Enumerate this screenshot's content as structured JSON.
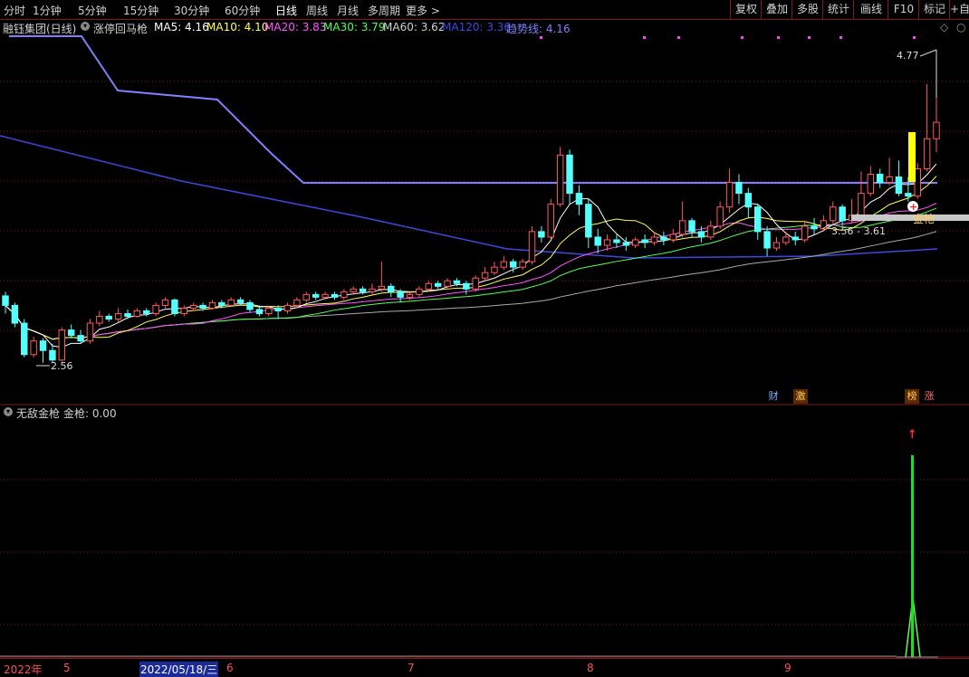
{
  "toolbar": {
    "periods": [
      "分时",
      "1分钟",
      "5分钟",
      "15分钟",
      "30分钟",
      "60分钟",
      "日线",
      "周线",
      "月线",
      "多周期",
      "更多 >"
    ],
    "active_period": "日线",
    "right_buttons": [
      "复权",
      "叠加",
      "多股",
      "统计",
      "画线",
      "F10",
      "标记",
      "+自"
    ]
  },
  "title_bar": {
    "stock_name": "融钰集团",
    "period": "(日线)",
    "formula_name": "涨停回马枪",
    "ma5_label": "MA5: 4.16",
    "ma10_label": "MA10: 4.10",
    "ma20_label": "MA20: 3.83",
    "ma30_label": "MA30: 3.79",
    "ma60_label": "MA60: 3.62",
    "ma120_label": "MA120: 3.36",
    "trend_label": "趋势线: 4.16"
  },
  "colors": {
    "up": "#ff5a5a",
    "down": "#54ffff",
    "ma5": "#ffffff",
    "ma10": "#ffff55",
    "ma20": "#ff55ff",
    "ma30": "#55ff55",
    "ma60": "#aaaaaa",
    "ma120": "#3a4ae0",
    "trend": "#8080ff",
    "grid": "#7a1c1c"
  },
  "annotations": {
    "high_label": "4.77",
    "low_label": "2.56",
    "range_label": "3.56 - 3.61",
    "jinqiang_label": "金枪"
  },
  "badges": [
    {
      "text": "财",
      "color": "#7fb2ff"
    },
    {
      "text": "激",
      "color": "#ffcc55"
    },
    {
      "text": "榜",
      "color": "#ffcc55"
    },
    {
      "text": "涨",
      "color": "#ff7070"
    }
  ],
  "sub_panel": {
    "indicator_name": "无敌金枪",
    "value_label": "金枪: 0.00"
  },
  "date_axis": {
    "labels": [
      "2022年",
      "5",
      "2022/05/18/三",
      "6",
      "7",
      "8",
      "9"
    ]
  },
  "chart_data": {
    "type": "candlestick",
    "ylim": [
      2.4,
      4.95
    ],
    "candles": [
      [
        3.05,
        2.98,
        3.08,
        2.92
      ],
      [
        2.98,
        2.85,
        3.0,
        2.82
      ],
      [
        2.85,
        2.62,
        2.88,
        2.6
      ],
      [
        2.62,
        2.72,
        2.75,
        2.6
      ],
      [
        2.72,
        2.65,
        2.74,
        2.56
      ],
      [
        2.65,
        2.58,
        2.7,
        2.56
      ],
      [
        2.58,
        2.8,
        2.82,
        2.57
      ],
      [
        2.8,
        2.76,
        2.84,
        2.74
      ],
      [
        2.76,
        2.72,
        2.8,
        2.7
      ],
      [
        2.72,
        2.85,
        2.88,
        2.7
      ],
      [
        2.85,
        2.9,
        2.94,
        2.83
      ],
      [
        2.9,
        2.88,
        2.92,
        2.86
      ],
      [
        2.88,
        2.92,
        2.96,
        2.86
      ],
      [
        2.92,
        2.9,
        2.95,
        2.88
      ],
      [
        2.9,
        2.94,
        2.96,
        2.89
      ],
      [
        2.94,
        2.92,
        2.96,
        2.9
      ],
      [
        2.92,
        2.98,
        3.0,
        2.9
      ],
      [
        2.98,
        3.02,
        3.04,
        2.96
      ],
      [
        3.02,
        2.92,
        3.03,
        2.9
      ],
      [
        2.92,
        2.96,
        2.98,
        2.9
      ],
      [
        2.96,
        2.98,
        3.0,
        2.94
      ],
      [
        2.98,
        2.96,
        3.0,
        2.94
      ],
      [
        2.96,
        3.0,
        3.02,
        2.95
      ],
      [
        3.0,
        2.98,
        3.02,
        2.96
      ],
      [
        2.98,
        3.02,
        3.04,
        2.97
      ],
      [
        3.02,
        3.0,
        3.04,
        2.98
      ],
      [
        3.0,
        2.95,
        3.02,
        2.93
      ],
      [
        2.95,
        2.92,
        2.98,
        2.9
      ],
      [
        2.92,
        2.96,
        2.98,
        2.9
      ],
      [
        2.96,
        2.94,
        2.98,
        2.88
      ],
      [
        2.94,
        2.98,
        3.0,
        2.92
      ],
      [
        2.98,
        3.02,
        3.04,
        2.96
      ],
      [
        3.02,
        3.06,
        3.08,
        3.0
      ],
      [
        3.06,
        3.04,
        3.08,
        3.02
      ],
      [
        3.04,
        3.06,
        3.08,
        3.02
      ],
      [
        3.06,
        3.04,
        3.08,
        3.02
      ],
      [
        3.04,
        3.08,
        3.1,
        3.02
      ],
      [
        3.08,
        3.1,
        3.12,
        3.06
      ],
      [
        3.1,
        3.08,
        3.12,
        3.06
      ],
      [
        3.08,
        3.1,
        3.14,
        3.06
      ],
      [
        3.1,
        3.12,
        3.3,
        3.08
      ],
      [
        3.12,
        3.08,
        3.14,
        3.04
      ],
      [
        3.08,
        3.04,
        3.1,
        3.0
      ],
      [
        3.04,
        3.06,
        3.08,
        3.02
      ],
      [
        3.06,
        3.1,
        3.12,
        3.04
      ],
      [
        3.1,
        3.14,
        3.16,
        3.08
      ],
      [
        3.14,
        3.12,
        3.16,
        3.1
      ],
      [
        3.12,
        3.16,
        3.18,
        3.1
      ],
      [
        3.16,
        3.14,
        3.18,
        3.12
      ],
      [
        3.14,
        3.1,
        3.16,
        3.06
      ],
      [
        3.1,
        3.18,
        3.2,
        3.08
      ],
      [
        3.18,
        3.22,
        3.26,
        3.16
      ],
      [
        3.22,
        3.26,
        3.3,
        3.2
      ],
      [
        3.26,
        3.3,
        3.34,
        3.24
      ],
      [
        3.3,
        3.26,
        3.32,
        3.22
      ],
      [
        3.26,
        3.3,
        3.32,
        3.24
      ],
      [
        3.3,
        3.52,
        3.56,
        3.28
      ],
      [
        3.52,
        3.48,
        3.56,
        3.44
      ],
      [
        3.48,
        3.72,
        3.76,
        3.46
      ],
      [
        3.72,
        4.08,
        4.14,
        3.7
      ],
      [
        4.08,
        3.8,
        4.12,
        3.72
      ],
      [
        3.8,
        3.72,
        3.86,
        3.64
      ],
      [
        3.72,
        3.48,
        3.76,
        3.4
      ],
      [
        3.48,
        3.42,
        3.54,
        3.36
      ],
      [
        3.42,
        3.46,
        3.5,
        3.38
      ],
      [
        3.46,
        3.44,
        3.5,
        3.4
      ],
      [
        3.44,
        3.42,
        3.48,
        3.38
      ],
      [
        3.42,
        3.46,
        3.48,
        3.4
      ],
      [
        3.46,
        3.44,
        3.5,
        3.4
      ],
      [
        3.44,
        3.48,
        3.52,
        3.42
      ],
      [
        3.48,
        3.46,
        3.52,
        3.42
      ],
      [
        3.46,
        3.5,
        3.54,
        3.44
      ],
      [
        3.5,
        3.6,
        3.74,
        3.48
      ],
      [
        3.6,
        3.52,
        3.62,
        3.48
      ],
      [
        3.52,
        3.48,
        3.56,
        3.44
      ],
      [
        3.48,
        3.56,
        3.6,
        3.46
      ],
      [
        3.56,
        3.7,
        3.74,
        3.54
      ],
      [
        3.7,
        3.88,
        3.98,
        3.66
      ],
      [
        3.88,
        3.8,
        3.94,
        3.72
      ],
      [
        3.8,
        3.7,
        3.84,
        3.62
      ],
      [
        3.7,
        3.52,
        3.72,
        3.46
      ],
      [
        3.52,
        3.4,
        3.56,
        3.34
      ],
      [
        3.4,
        3.44,
        3.48,
        3.38
      ],
      [
        3.44,
        3.48,
        3.52,
        3.42
      ],
      [
        3.48,
        3.46,
        3.52,
        3.42
      ],
      [
        3.46,
        3.56,
        3.6,
        3.44
      ],
      [
        3.56,
        3.54,
        3.62,
        3.5
      ],
      [
        3.54,
        3.6,
        3.64,
        3.52
      ],
      [
        3.6,
        3.7,
        3.74,
        3.58
      ],
      [
        3.7,
        3.6,
        3.72,
        3.56
      ],
      [
        3.6,
        3.64,
        3.76,
        3.58
      ],
      [
        3.64,
        3.8,
        3.96,
        3.62
      ],
      [
        3.8,
        3.94,
        4.0,
        3.78
      ],
      [
        3.94,
        3.88,
        3.98,
        3.84
      ],
      [
        3.88,
        3.92,
        4.06,
        3.86
      ],
      [
        3.92,
        3.8,
        4.04,
        3.78
      ],
      [
        3.8,
        3.78,
        3.92,
        3.74
      ],
      [
        3.78,
        3.98,
        4.02,
        3.76
      ],
      [
        3.98,
        4.2,
        4.6,
        3.96
      ],
      [
        4.2,
        4.32,
        4.77,
        4.1
      ]
    ]
  }
}
